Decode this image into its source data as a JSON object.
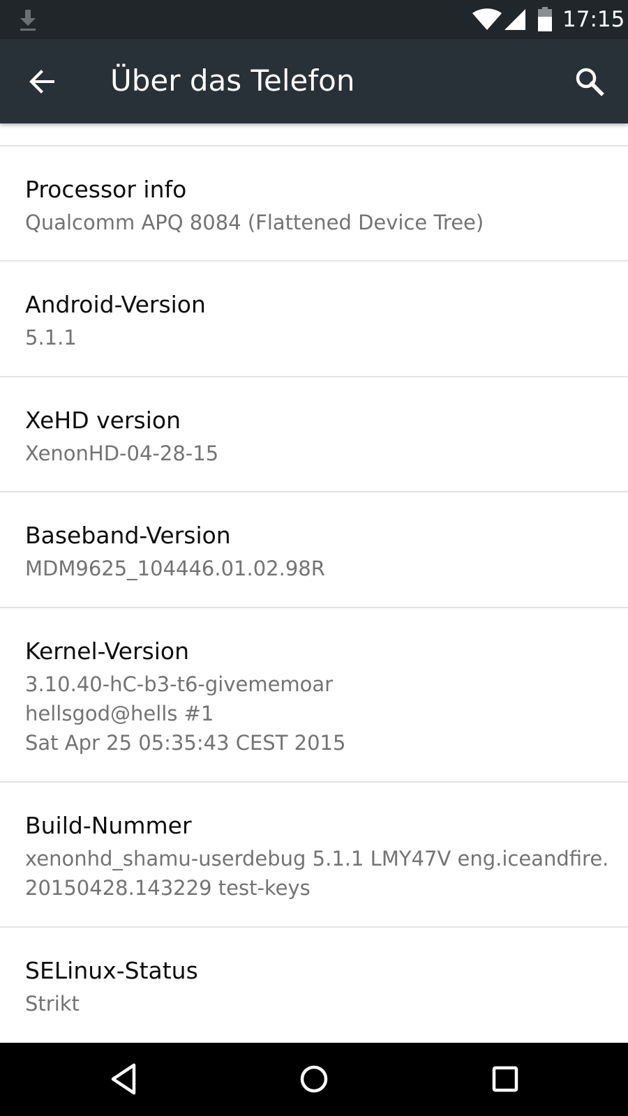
{
  "status_bar": {
    "time": "17:15",
    "icons": [
      "download-icon",
      "wifi-icon",
      "signal-icon",
      "battery-icon"
    ]
  },
  "app_bar": {
    "title": "Über das Telefon",
    "icons": [
      "back-arrow-icon",
      "search-icon"
    ]
  },
  "items": [
    {
      "title": "Processor info",
      "summary": [
        "Qualcomm APQ 8084 (Flattened Device Tree)"
      ]
    },
    {
      "title": "Android-Version",
      "summary": [
        "5.1.1"
      ]
    },
    {
      "title": "XeHD version",
      "summary": [
        "XenonHD-04-28-15"
      ]
    },
    {
      "title": "Baseband-Version",
      "summary": [
        "MDM9625_104446.01.02.98R"
      ]
    },
    {
      "title": "Kernel-Version",
      "summary": [
        "3.10.40-hC-b3-t6-givememoar",
        "hellsgod@hells #1",
        "Sat Apr 25 05:35:43 CEST 2015"
      ]
    },
    {
      "title": "Build-Nummer",
      "summary": [
        "xenonhd_shamu-userdebug 5.1.1 LMY47V eng.iceandfire.",
        "20150428.143229 test-keys"
      ]
    },
    {
      "title": "SELinux-Status",
      "summary": [
        "Strikt"
      ]
    }
  ],
  "nav_bar": {
    "icons": [
      "nav-back-icon",
      "nav-home-icon",
      "nav-recents-icon"
    ]
  }
}
